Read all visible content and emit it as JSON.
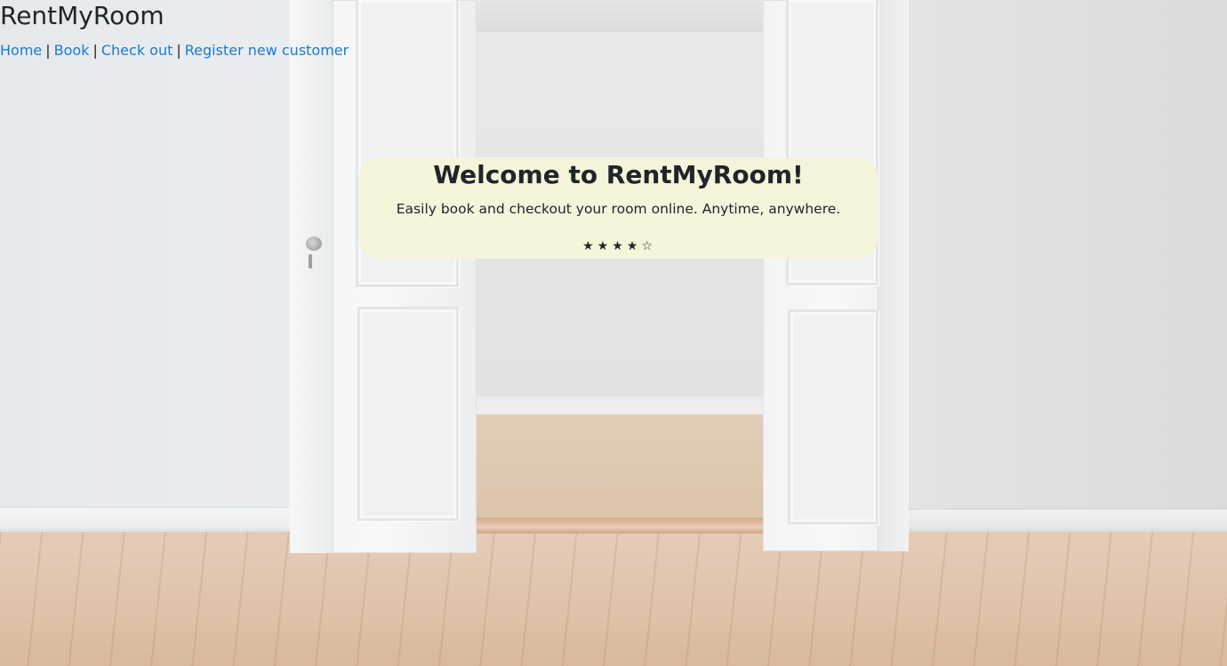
{
  "site": {
    "title": "RentMyRoom"
  },
  "nav": {
    "items": [
      {
        "label": "Home"
      },
      {
        "label": "Book"
      },
      {
        "label": "Check out"
      },
      {
        "label": "Register new customer"
      }
    ],
    "separator": "|"
  },
  "welcome": {
    "title": "Welcome to RentMyRoom!",
    "subtitle": "Easily book and checkout your room online. Anytime, anywhere.",
    "rating": {
      "value": 4,
      "max": 5,
      "filled_glyph": "★",
      "empty_glyph": "☆"
    },
    "card_color": "#f5f5dc"
  },
  "theme": {
    "link_color": "#1a7ad6",
    "text_color": "#212529"
  },
  "background": {
    "scene": "empty room with open white double doors and wooden floor"
  }
}
